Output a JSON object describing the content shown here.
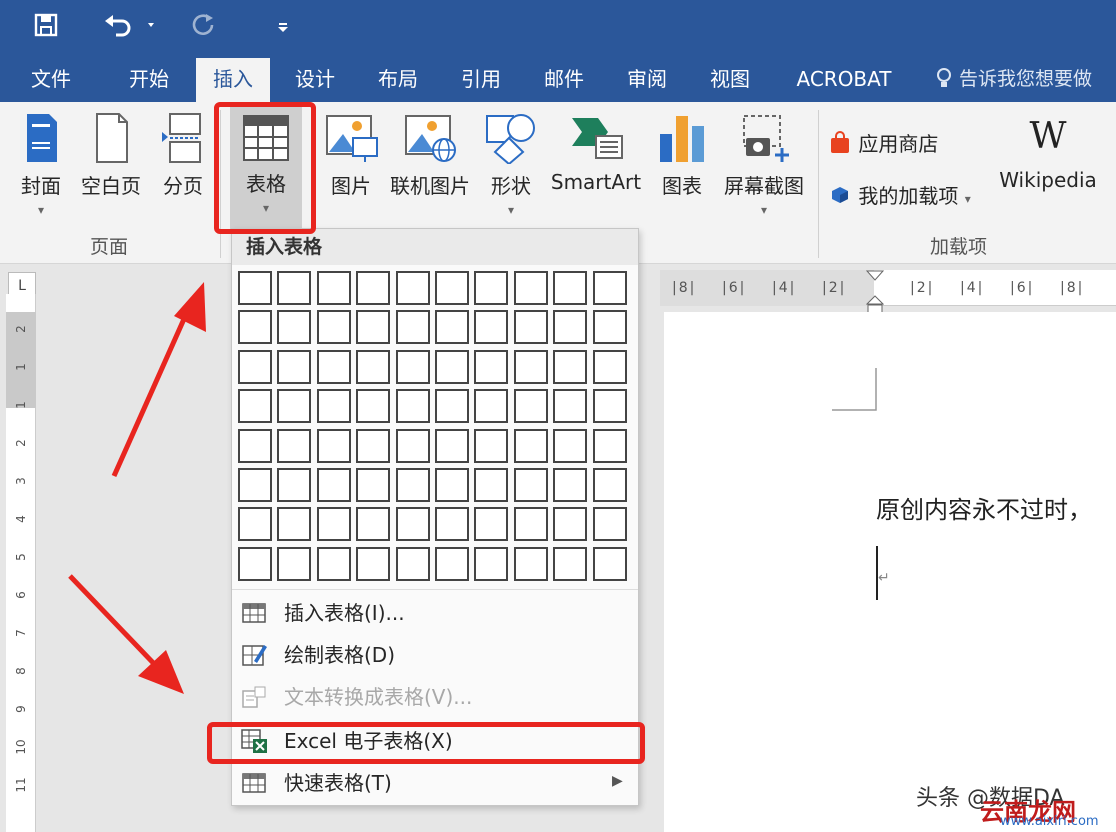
{
  "quick_access": {
    "save_icon": "save-icon",
    "undo_icon": "undo-icon",
    "redo_icon": "redo-icon",
    "customize_icon": "customize-icon"
  },
  "tabs": [
    "文件",
    "开始",
    "插入",
    "设计",
    "布局",
    "引用",
    "邮件",
    "审阅",
    "视图",
    "ACROBAT"
  ],
  "active_tab": "插入",
  "tell_me": "告诉我您想要做",
  "ribbon": {
    "pages_group": {
      "label": "页面",
      "items": [
        "封面",
        "空白页",
        "分页"
      ]
    },
    "table_button": "表格",
    "illustrations": [
      "图片",
      "联机图片",
      "形状",
      "SmartArt",
      "图表",
      "屏幕截图"
    ],
    "addins_group": {
      "label": "加载项",
      "store": "应用商店",
      "my_addins": "我的加载项",
      "wikipedia": "Wikipedia"
    }
  },
  "insert_table_menu": {
    "header": "插入表格",
    "grid_cols": 10,
    "grid_rows": 8,
    "items": [
      {
        "label": "插入表格(I)...",
        "icon": "table-icon",
        "enabled": true
      },
      {
        "label": "绘制表格(D)",
        "icon": "draw-table-icon",
        "enabled": true
      },
      {
        "label": "文本转换成表格(V)...",
        "icon": "convert-text-icon",
        "enabled": false
      },
      {
        "label": "Excel 电子表格(X)",
        "icon": "excel-icon",
        "enabled": true
      },
      {
        "label": "快速表格(T)",
        "icon": "quick-table-icon",
        "enabled": true
      }
    ]
  },
  "vertical_ruler": [
    "2",
    "1",
    "1",
    "2",
    "3",
    "4",
    "5",
    "6",
    "7",
    "8",
    "9",
    "10",
    "11"
  ],
  "horizontal_ruler": [
    "8",
    "6",
    "4",
    "2",
    "2",
    "4",
    "6",
    "8"
  ],
  "document": {
    "text": "原创内容永不过时，"
  },
  "watermark": {
    "brand": "头条 @数据DA",
    "site": "云南龙网",
    "url": "www.aixiri.com"
  },
  "colors": {
    "accent": "#2b579a",
    "highlight": "#e8251f",
    "excel_green": "#1e7145"
  }
}
